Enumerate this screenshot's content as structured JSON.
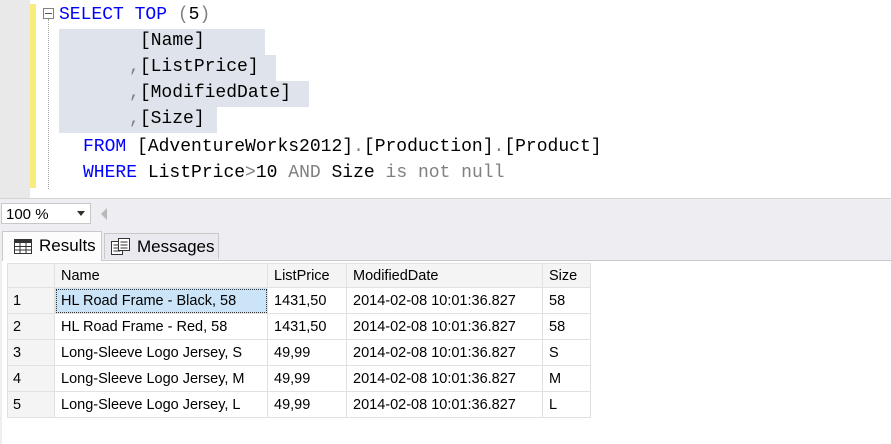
{
  "editor": {
    "lines": [
      {
        "kw": "SELECT",
        "kw2": "TOP",
        "op": "(",
        "num": "5",
        "op2": ")"
      },
      {
        "text": "[Name]"
      },
      {
        "comma": ",",
        "text": "[ListPrice]"
      },
      {
        "comma": ",",
        "text": "[ModifiedDate]"
      },
      {
        "comma": ",",
        "text": "[Size]"
      },
      {
        "kw": "FROM",
        "p1": "[AdventureWorks2012]",
        "d1": ".",
        "p2": "[Production]",
        "d2": ".",
        "p3": "[Product]"
      },
      {
        "kw": "WHERE",
        "col": "ListPrice",
        "op": ">",
        "num": "10",
        "and": "AND",
        "col2": "Size",
        "is": "is",
        "not": "not",
        "null": "null"
      }
    ]
  },
  "zoom": {
    "value": "100 %"
  },
  "tabs": {
    "results": "Results",
    "messages": "Messages"
  },
  "grid": {
    "columns": [
      "Name",
      "ListPrice",
      "ModifiedDate",
      "Size"
    ],
    "rows": [
      {
        "num": "1",
        "name": "HL Road Frame - Black, 58",
        "price": "1431,50",
        "date": "2014-02-08 10:01:36.827",
        "size": "58"
      },
      {
        "num": "2",
        "name": "HL Road Frame - Red, 58",
        "price": "1431,50",
        "date": "2014-02-08 10:01:36.827",
        "size": "58"
      },
      {
        "num": "3",
        "name": "Long-Sleeve Logo Jersey, S",
        "price": "49,99",
        "date": "2014-02-08 10:01:36.827",
        "size": "S"
      },
      {
        "num": "4",
        "name": "Long-Sleeve Logo Jersey, M",
        "price": "49,99",
        "date": "2014-02-08 10:01:36.827",
        "size": "M"
      },
      {
        "num": "5",
        "name": "Long-Sleeve Logo Jersey, L",
        "price": "49,99",
        "date": "2014-02-08 10:01:36.827",
        "size": "L"
      }
    ],
    "selected_cell": "1.name"
  },
  "colors": {
    "keyword": "#0000ff",
    "operator": "#808080",
    "selection": "#dfe4ec",
    "change_bar": "#f7ec7c",
    "selected_cell": "#cce4f7"
  }
}
